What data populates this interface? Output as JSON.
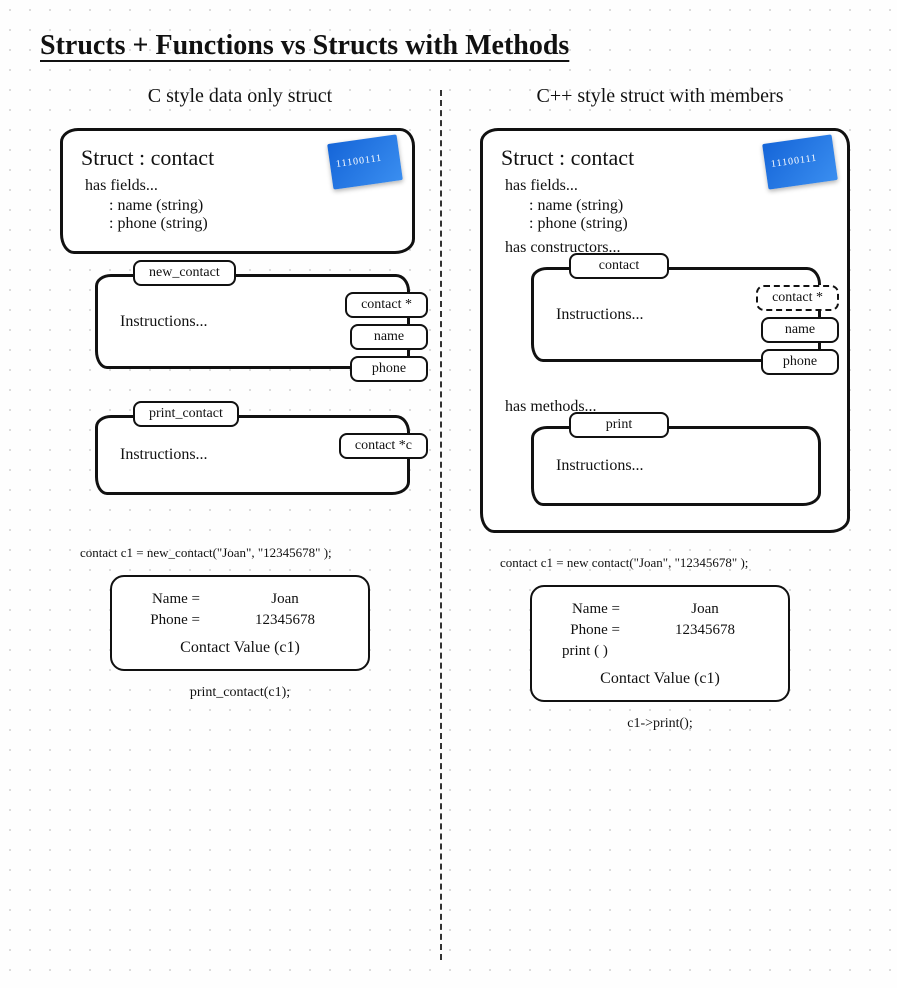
{
  "title": "Structs + Functions vs Structs with Methods",
  "left": {
    "heading": "C style data only struct",
    "struct_title": "Struct : contact",
    "has_fields": "has fields...",
    "field1": ": name (string)",
    "field2": ": phone (string)",
    "fn1": {
      "name": "new_contact",
      "ret": "contact *",
      "body": "Instructions...",
      "arg1": "name",
      "arg2": "phone"
    },
    "fn2": {
      "name": "print_contact",
      "ret": "contact *c",
      "body": "Instructions..."
    },
    "code1": "contact c1 = new_contact(\"Joan\", \"12345678\" );",
    "value": {
      "name_label": "Name =",
      "name_val": "Joan",
      "phone_label": "Phone =",
      "phone_val": "12345678",
      "caption": "Contact Value (c1)"
    },
    "code2": "print_contact(c1);"
  },
  "right": {
    "heading": "C++ style struct with members",
    "struct_title": "Struct : contact",
    "has_fields": "has fields...",
    "field1": ": name (string)",
    "field2": ": phone (string)",
    "has_constructors": "has constructors...",
    "ctor": {
      "name": "contact",
      "ret": "contact *",
      "body": "Instructions...",
      "arg1": "name",
      "arg2": "phone"
    },
    "has_methods": "has methods...",
    "method": {
      "name": "print",
      "body": "Instructions..."
    },
    "code1": "contact c1 = new contact(\"Joan\", \"12345678\" );",
    "value": {
      "name_label": "Name =",
      "name_val": "Joan",
      "phone_label": "Phone =",
      "phone_val": "12345678",
      "method": "print ( )",
      "caption": "Contact Value (c1)"
    },
    "code2": "c1->print();"
  }
}
